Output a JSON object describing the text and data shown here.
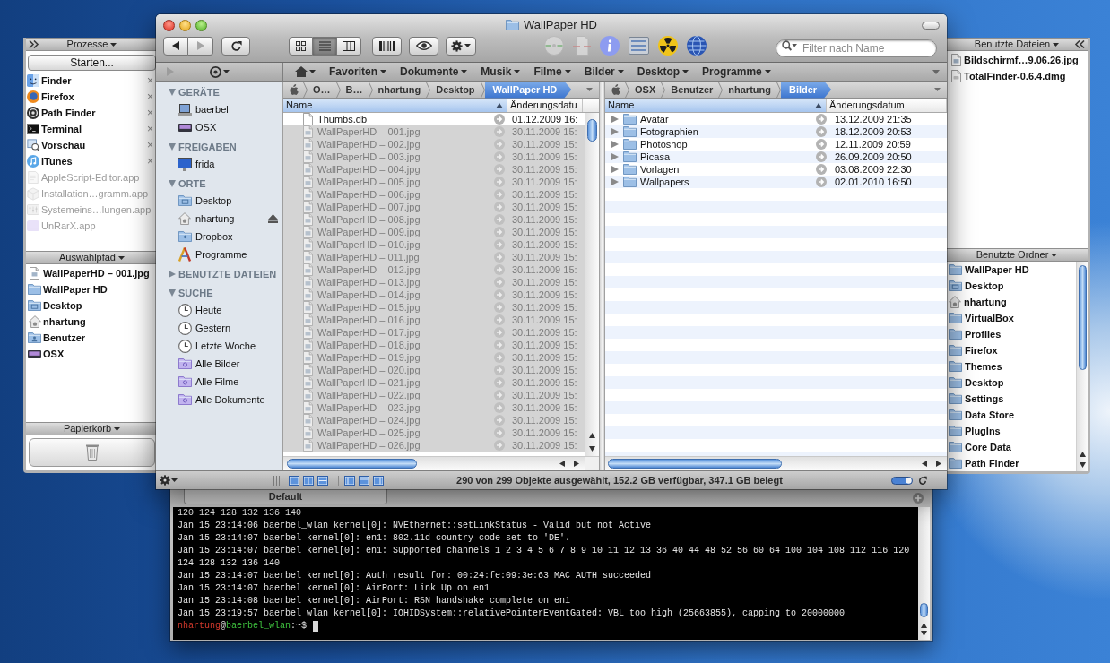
{
  "process_drawer": {
    "title": "Prozesse",
    "start_button": "Starten...",
    "close_glyph": "×",
    "processes": [
      {
        "name": "Finder",
        "kind": "finder",
        "running": true
      },
      {
        "name": "Firefox",
        "kind": "browser",
        "running": true
      },
      {
        "name": "Path Finder",
        "kind": "pathfinder",
        "running": true
      },
      {
        "name": "Terminal",
        "kind": "terminal",
        "running": true
      },
      {
        "name": "Vorschau",
        "kind": "preview",
        "running": true
      },
      {
        "name": "iTunes",
        "kind": "music",
        "running": true
      },
      {
        "name": "AppleScript-Editor.app",
        "kind": "script",
        "running": false
      },
      {
        "name": "Installation…gramm.app",
        "kind": "installer",
        "running": false
      },
      {
        "name": "Systemeins…lungen.app",
        "kind": "settings",
        "running": false
      },
      {
        "name": "UnRarX.app",
        "kind": "archive",
        "running": false
      }
    ],
    "selection_path": {
      "title": "Auswahlpfad",
      "items": [
        {
          "name": "WallPaperHD – 001.jpg",
          "kind": "image-file"
        },
        {
          "name": "WallPaper HD",
          "kind": "folder"
        },
        {
          "name": "Desktop",
          "kind": "desktop-folder"
        },
        {
          "name": "nhartung",
          "kind": "home"
        },
        {
          "name": "Benutzer",
          "kind": "users-folder"
        },
        {
          "name": "OSX",
          "kind": "disk"
        }
      ]
    },
    "trash": {
      "title": "Papierkorb"
    }
  },
  "finder_window": {
    "title": "WallPaper HD",
    "navigation": [
      {
        "kind": "back",
        "disabled": false
      },
      {
        "kind": "forward",
        "disabled": true
      }
    ],
    "view_modes": [
      {
        "kind": "icons",
        "selected": false
      },
      {
        "kind": "list",
        "selected": true
      },
      {
        "kind": "columns",
        "selected": false
      }
    ],
    "search": {
      "placeholder": "Filter nach Name"
    },
    "bookmarks": [
      "Favoriten",
      "Dokumente",
      "Musik",
      "Filme",
      "Bilder",
      "Desktop",
      "Programme"
    ],
    "sidebar": [
      {
        "title": "GERÄTE",
        "expanded": true,
        "items": [
          {
            "name": "baerbel",
            "kind": "laptop",
            "ejectable": false
          },
          {
            "name": "OSX",
            "kind": "disk",
            "ejectable": false
          }
        ]
      },
      {
        "title": "FREIGABEN",
        "expanded": true,
        "items": [
          {
            "name": "frida",
            "kind": "monitor",
            "ejectable": false
          }
        ]
      },
      {
        "title": "ORTE",
        "expanded": true,
        "items": [
          {
            "name": "Desktop",
            "kind": "desktop-folder",
            "ejectable": false
          },
          {
            "name": "nhartung",
            "kind": "home",
            "ejectable": true
          },
          {
            "name": "Dropbox",
            "kind": "dropbox-folder",
            "ejectable": false
          },
          {
            "name": "Programme",
            "kind": "apps",
            "ejectable": false
          }
        ]
      },
      {
        "title": "BENUTZTE DATEIEN",
        "expanded": false
      },
      {
        "title": "SUCHE",
        "expanded": true,
        "items": [
          {
            "name": "Heute",
            "kind": "clock",
            "ejectable": false
          },
          {
            "name": "Gestern",
            "kind": "clock",
            "ejectable": false
          },
          {
            "name": "Letzte Woche",
            "kind": "clock",
            "ejectable": false
          },
          {
            "name": "Alle Bilder",
            "kind": "smart-folder",
            "ejectable": false
          },
          {
            "name": "Alle Filme",
            "kind": "smart-folder",
            "ejectable": false
          },
          {
            "name": "Alle Dokumente",
            "kind": "smart-folder",
            "ejectable": false
          }
        ]
      }
    ],
    "left_pane": {
      "path": [
        {
          "label": "O…",
          "selected": false
        },
        {
          "label": "B…",
          "selected": false
        },
        {
          "label": "nhartung",
          "selected": false
        },
        {
          "label": "Desktop",
          "selected": false
        },
        {
          "label": "WallPaper HD",
          "selected": true
        }
      ],
      "columns": [
        {
          "label": "Name",
          "selected": true
        },
        {
          "label": "Änderungsdatu",
          "selected": false
        }
      ],
      "rows": [
        {
          "name": "Thumbs.db",
          "kind": "file",
          "date": "01.12.2009 16:",
          "selected": false
        },
        {
          "name": "WallPaperHD – 001.jpg",
          "kind": "image-file",
          "date": "30.11.2009 15:",
          "selected": true
        },
        {
          "name": "WallPaperHD – 002.jpg",
          "kind": "image-file",
          "date": "30.11.2009 15:",
          "selected": true
        },
        {
          "name": "WallPaperHD – 003.jpg",
          "kind": "image-file",
          "date": "30.11.2009 15:",
          "selected": true
        },
        {
          "name": "WallPaperHD – 004.jpg",
          "kind": "image-file",
          "date": "30.11.2009 15:",
          "selected": true
        },
        {
          "name": "WallPaperHD – 005.jpg",
          "kind": "image-file",
          "date": "30.11.2009 15:",
          "selected": true
        },
        {
          "name": "WallPaperHD – 006.jpg",
          "kind": "image-file",
          "date": "30.11.2009 15:",
          "selected": true
        },
        {
          "name": "WallPaperHD – 007.jpg",
          "kind": "image-file",
          "date": "30.11.2009 15:",
          "selected": true
        },
        {
          "name": "WallPaperHD – 008.jpg",
          "kind": "image-file",
          "date": "30.11.2009 15:",
          "selected": true
        },
        {
          "name": "WallPaperHD – 009.jpg",
          "kind": "image-file",
          "date": "30.11.2009 15:",
          "selected": true
        },
        {
          "name": "WallPaperHD – 010.jpg",
          "kind": "image-file",
          "date": "30.11.2009 15:",
          "selected": true
        },
        {
          "name": "WallPaperHD – 011.jpg",
          "kind": "image-file",
          "date": "30.11.2009 15:",
          "selected": true
        },
        {
          "name": "WallPaperHD – 012.jpg",
          "kind": "image-file",
          "date": "30.11.2009 15:",
          "selected": true
        },
        {
          "name": "WallPaperHD – 013.jpg",
          "kind": "image-file",
          "date": "30.11.2009 15:",
          "selected": true
        },
        {
          "name": "WallPaperHD – 014.jpg",
          "kind": "image-file",
          "date": "30.11.2009 15:",
          "selected": true
        },
        {
          "name": "WallPaperHD – 015.jpg",
          "kind": "image-file",
          "date": "30.11.2009 15:",
          "selected": true
        },
        {
          "name": "WallPaperHD – 016.jpg",
          "kind": "image-file",
          "date": "30.11.2009 15:",
          "selected": true
        },
        {
          "name": "WallPaperHD – 017.jpg",
          "kind": "image-file",
          "date": "30.11.2009 15:",
          "selected": true
        },
        {
          "name": "WallPaperHD – 018.jpg",
          "kind": "image-file",
          "date": "30.11.2009 15:",
          "selected": true
        },
        {
          "name": "WallPaperHD – 019.jpg",
          "kind": "image-file",
          "date": "30.11.2009 15:",
          "selected": true
        },
        {
          "name": "WallPaperHD – 020.jpg",
          "kind": "image-file",
          "date": "30.11.2009 15:",
          "selected": true
        },
        {
          "name": "WallPaperHD – 021.jpg",
          "kind": "image-file",
          "date": "30.11.2009 15:",
          "selected": true
        },
        {
          "name": "WallPaperHD – 022.jpg",
          "kind": "image-file",
          "date": "30.11.2009 15:",
          "selected": true
        },
        {
          "name": "WallPaperHD – 023.jpg",
          "kind": "image-file",
          "date": "30.11.2009 15:",
          "selected": true
        },
        {
          "name": "WallPaperHD – 024.jpg",
          "kind": "image-file",
          "date": "30.11.2009 15:",
          "selected": true
        },
        {
          "name": "WallPaperHD – 025.jpg",
          "kind": "image-file",
          "date": "30.11.2009 15:",
          "selected": true
        },
        {
          "name": "WallPaperHD – 026.jpg",
          "kind": "image-file",
          "date": "30.11.2009 15:",
          "selected": true
        }
      ]
    },
    "right_pane": {
      "path": [
        {
          "label": "OSX",
          "selected": false
        },
        {
          "label": "Benutzer",
          "selected": false
        },
        {
          "label": "nhartung",
          "selected": false
        },
        {
          "label": "Bilder",
          "selected": true
        }
      ],
      "columns": [
        {
          "label": "Name",
          "selected": true
        },
        {
          "label": "Änderungsdatum",
          "selected": false
        }
      ],
      "rows": [
        {
          "name": "Avatar",
          "date": "13.12.2009 21:35",
          "expanded": false
        },
        {
          "name": "Fotographien",
          "date": "18.12.2009 20:53",
          "expanded": false
        },
        {
          "name": "Photoshop",
          "date": "12.11.2009 20:59",
          "expanded": false
        },
        {
          "name": "Picasa",
          "date": "26.09.2009 20:50",
          "expanded": false
        },
        {
          "name": "Vorlagen",
          "date": "03.08.2009 22:30",
          "expanded": false
        },
        {
          "name": "Wallpapers",
          "date": "02.01.2010 16:50",
          "expanded": false
        }
      ]
    },
    "status_bar": {
      "text": "290 von 299 Objekte ausgewählt, 152.2 GB verfügbar, 347.1 GB belegt"
    }
  },
  "recent_drawer": {
    "files": {
      "title": "Benutzte Dateien",
      "items": [
        {
          "name": "Bildschirmf…9.06.26.jpg",
          "kind": "image-file"
        },
        {
          "name": "TotalFinder-0.6.4.dmg",
          "kind": "disk-image"
        }
      ]
    },
    "folders": {
      "title": "Benutzte Ordner",
      "items": [
        {
          "name": "WallPaper HD",
          "kind": "folder"
        },
        {
          "name": "Desktop",
          "kind": "desktop-folder"
        },
        {
          "name": "nhartung",
          "kind": "home"
        },
        {
          "name": "VirtualBox",
          "kind": "folder"
        },
        {
          "name": "Profiles",
          "kind": "folder"
        },
        {
          "name": "Firefox",
          "kind": "folder"
        },
        {
          "name": "Themes",
          "kind": "folder"
        },
        {
          "name": "Desktop",
          "kind": "folder"
        },
        {
          "name": "Settings",
          "kind": "folder"
        },
        {
          "name": "Data Store",
          "kind": "folder"
        },
        {
          "name": "PlugIns",
          "kind": "folder"
        },
        {
          "name": "Core Data",
          "kind": "folder"
        },
        {
          "name": "Path Finder",
          "kind": "folder"
        }
      ]
    }
  },
  "terminal": {
    "tabs": [
      {
        "label": "Default",
        "selected": true
      }
    ],
    "lines": [
      "120 124 128 132 136 140",
      "Jan 15 23:14:06 baerbel_wlan kernel[0]: NVEthernet::setLinkStatus - Valid but not Active",
      "Jan 15 23:14:07 baerbel kernel[0]: en1: 802.11d country code set to 'DE'.",
      "Jan 15 23:14:07 baerbel kernel[0]: en1: Supported channels 1 2 3 4 5 6 7 8 9 10 11 12 13 36 40 44 48 52 56 60 64 100 104 108 112 116 120",
      "124 128 132 136 140",
      "Jan 15 23:14:07 baerbel kernel[0]: Auth result for: 00:24:fe:09:3e:63 MAC AUTH succeeded",
      "Jan 15 23:14:07 baerbel kernel[0]: AirPort: Link Up on en1",
      "Jan 15 23:14:08 baerbel kernel[0]: AirPort: RSN handshake complete on en1",
      "Jan 15 23:19:57 baerbel_wlan kernel[0]: IOHIDSystem::relativePointerEventGated: VBL too high (25663855), capping to 20000000"
    ],
    "prompt": [
      {
        "text": "nhartung",
        "color": "#d2392c"
      },
      {
        "text": "@"
      },
      {
        "text": "baerbel_wlan",
        "color": "#3fc23f"
      },
      {
        "text": ":~$"
      }
    ]
  }
}
